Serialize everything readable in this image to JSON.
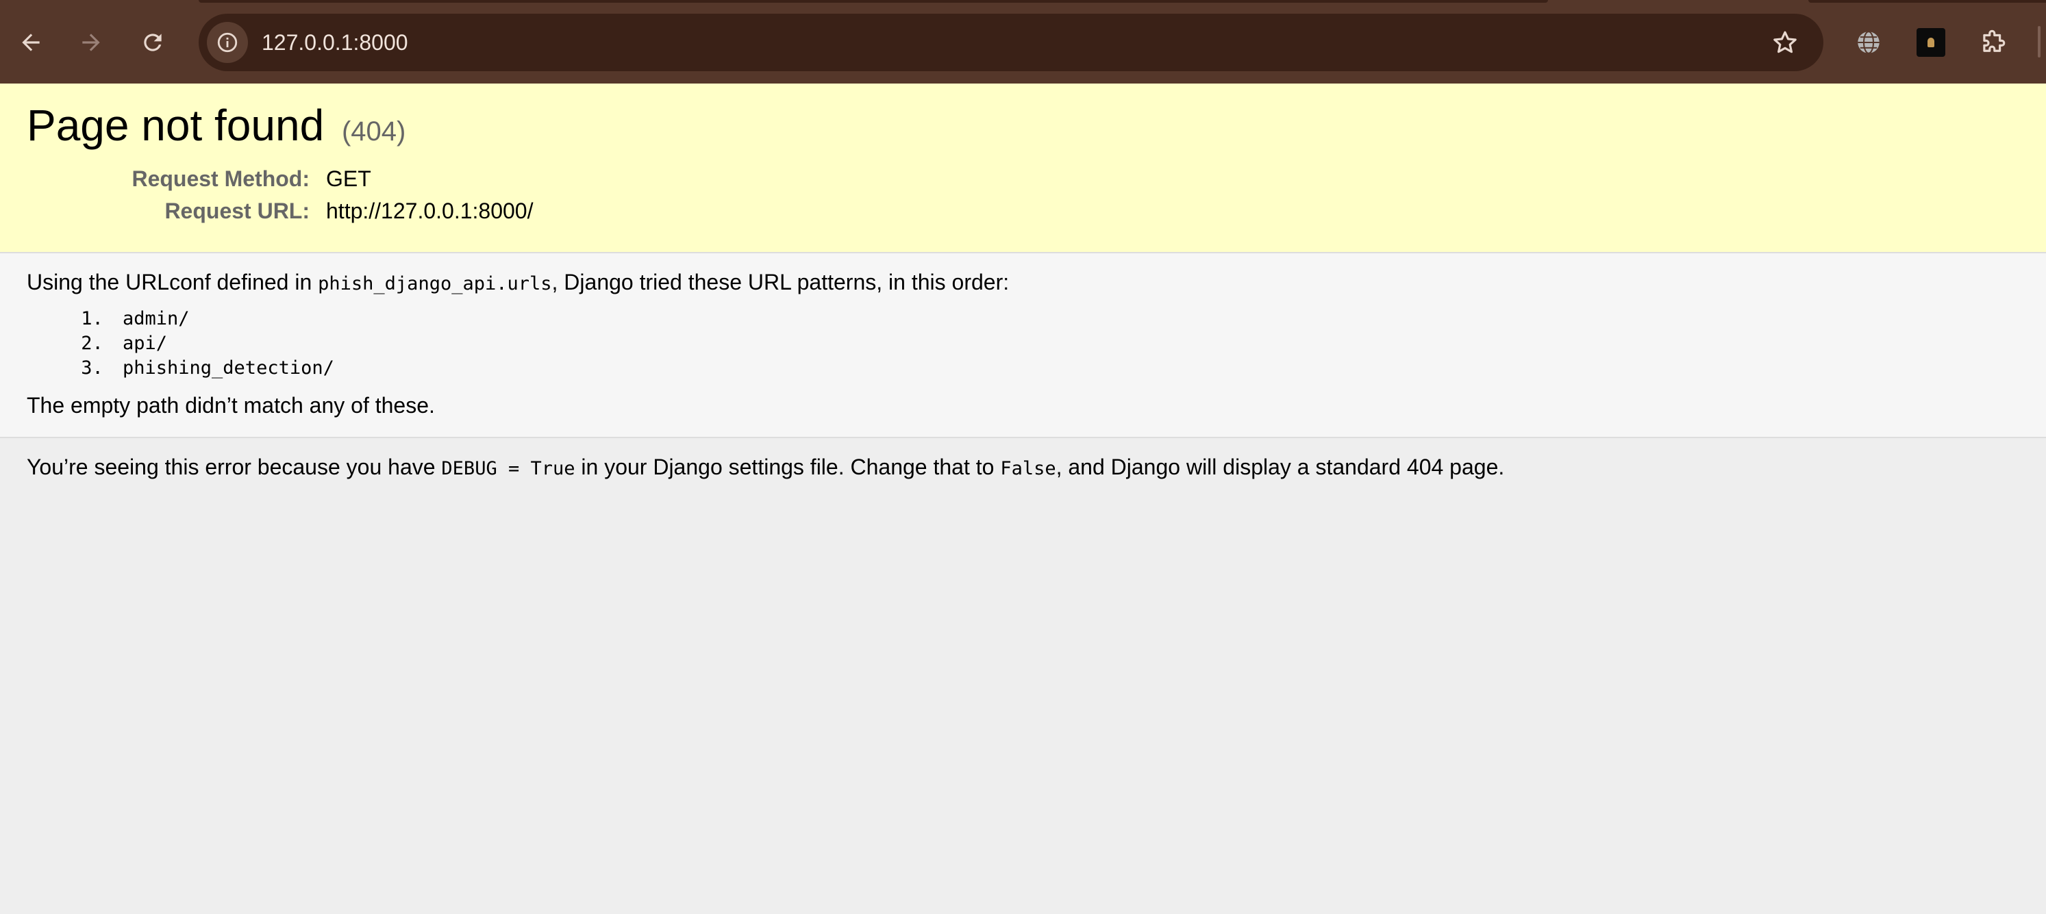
{
  "browser": {
    "url": "127.0.0.1:8000",
    "icons": {
      "back": "arrow-left-icon",
      "forward": "arrow-right-icon",
      "reload": "reload-icon",
      "site_info": "info-icon",
      "bookmark": "star-icon",
      "translate": "globe-icon",
      "extension": "extension-app-icon",
      "extensions_menu": "puzzle-piece-icon"
    }
  },
  "summary": {
    "title": "Page not found",
    "code": "(404)",
    "method_label": "Request Method:",
    "method_value": "GET",
    "url_label": "Request URL:",
    "url_value": "http://127.0.0.1:8000/"
  },
  "info": {
    "intro_prefix": "Using the URLconf defined in ",
    "urlconf": "phish_django_api.urls",
    "intro_suffix": ", Django tried these URL patterns, in this order:",
    "patterns": [
      "admin/",
      "api/",
      "phishing_detection/"
    ],
    "no_match": "The empty path didn’t match any of these."
  },
  "explanation": {
    "part1": "You’re seeing this error because you have ",
    "code1": "DEBUG = True",
    "part2": " in your Django settings file. Change that to ",
    "code2": "False",
    "part3": ", and Django will display a standard 404 page."
  },
  "colors": {
    "chrome": "#55372a",
    "omnibox": "#3a2117",
    "summary_bg": "#ffffc8",
    "info_bg": "#f6f6f6",
    "page_bg": "#eeeeee",
    "label_gray": "#666666"
  }
}
